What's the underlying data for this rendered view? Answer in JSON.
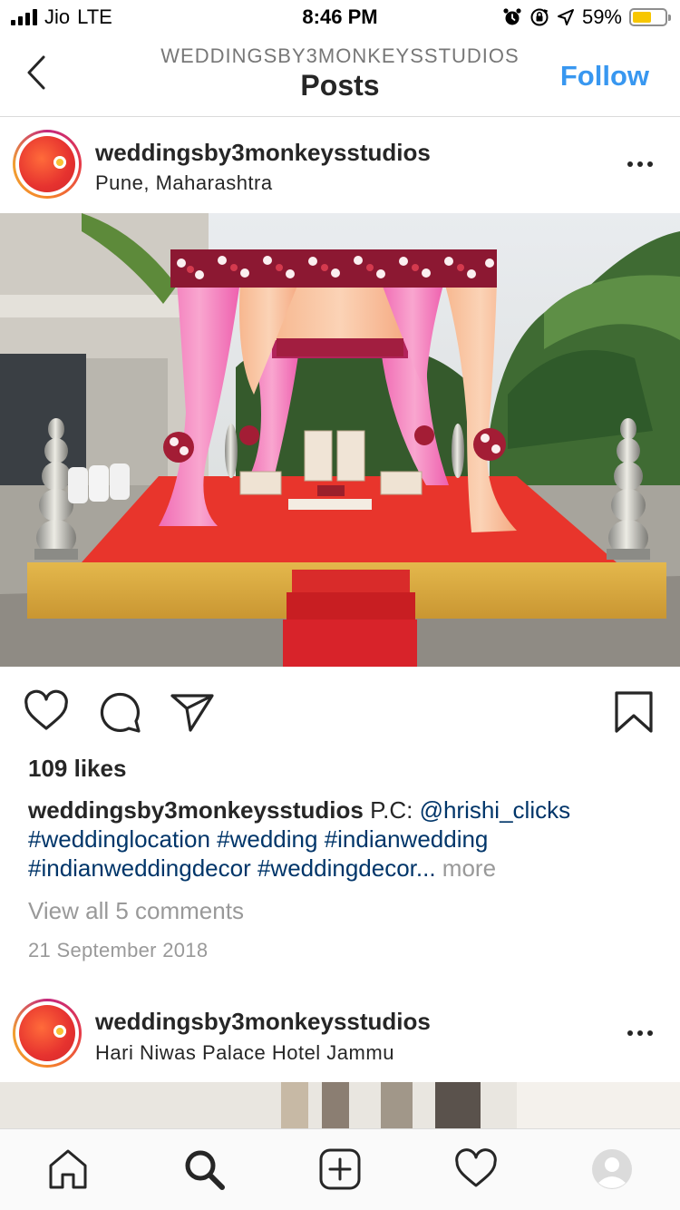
{
  "status_bar": {
    "carrier": "Jio",
    "network": "LTE",
    "time": "8:46 PM",
    "battery_percent": "59%",
    "battery_level": 0.59,
    "battery_color": "#f7c600"
  },
  "nav": {
    "subtitle": "WEDDINGSBY3MONKEYSSTUDIOS",
    "title": "Posts",
    "follow_label": "Follow",
    "back_icon": "chevron-left-icon",
    "accent_color": "#3897f0"
  },
  "post": {
    "username": "weddingsby3monkeysstudios",
    "location": "Pune, Maharashtra",
    "likes": "109 likes",
    "caption": {
      "username": "weddingsby3monkeysstudios",
      "text": "P.C:",
      "mention": "@hrishi_clicks",
      "line2": "#weddinglocation #wedding #indianwedding",
      "line3": "#indianweddingdecor #weddingdecor...",
      "more": "more"
    },
    "comments_link": "View all 5 comments",
    "date": "21 September 2018",
    "hashtag_color": "#003569"
  },
  "next_post": {
    "username": "weddingsby3monkeysstudios",
    "location": "Hari Niwas Palace Hotel Jammu"
  },
  "actions": [
    "heart-icon",
    "comment-icon",
    "share-icon",
    "bookmark-icon"
  ],
  "tabbar": [
    "home-icon",
    "search-icon",
    "add-post-icon",
    "activity-heart-icon",
    "profile-avatar-icon"
  ]
}
